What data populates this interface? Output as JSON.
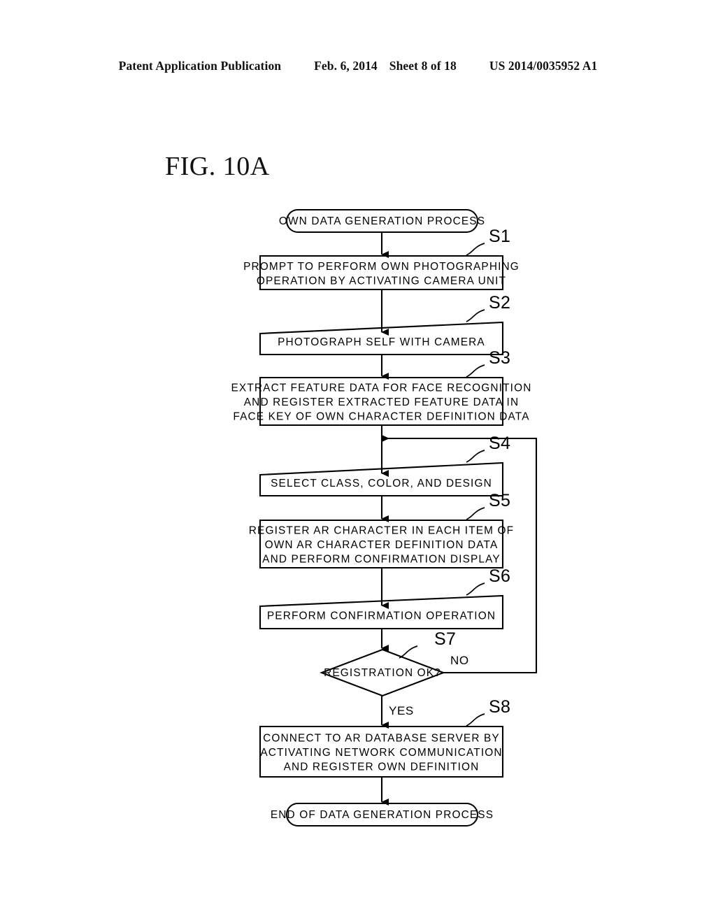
{
  "header": {
    "publication": "Patent Application Publication",
    "date": "Feb. 6, 2014",
    "sheet": "Sheet 8 of 18",
    "patent_number": "US 2014/0035952 A1"
  },
  "figure": {
    "label": "FIG. 10A"
  },
  "flowchart": {
    "start": {
      "id": "start",
      "type": "terminator",
      "text": "OWN DATA GENERATION PROCESS"
    },
    "end": {
      "id": "end",
      "type": "terminator",
      "text": "END OF DATA GENERATION PROCESS"
    },
    "steps": [
      {
        "id": "S1",
        "step_label": "S1",
        "type": "process",
        "lines": [
          "PROMPT TO PERFORM OWN PHOTOGRAPHING",
          "OPERATION BY ACTIVATING CAMERA UNIT"
        ]
      },
      {
        "id": "S2",
        "step_label": "S2",
        "type": "process",
        "lines": [
          "PHOTOGRAPH SELF WITH CAMERA"
        ]
      },
      {
        "id": "S3",
        "step_label": "S3",
        "type": "process",
        "lines": [
          "EXTRACT FEATURE DATA FOR FACE RECOGNITION",
          "AND REGISTER EXTRACTED FEATURE DATA IN",
          "FACE KEY OF OWN CHARACTER DEFINITION DATA"
        ]
      },
      {
        "id": "S4",
        "step_label": "S4",
        "type": "process",
        "lines": [
          "SELECT CLASS, COLOR, AND DESIGN"
        ]
      },
      {
        "id": "S5",
        "step_label": "S5",
        "type": "process",
        "lines": [
          "REGISTER AR CHARACTER IN EACH ITEM OF",
          "OWN AR CHARACTER DEFINITION DATA",
          "AND PERFORM CONFIRMATION DISPLAY"
        ]
      },
      {
        "id": "S6",
        "step_label": "S6",
        "type": "process",
        "lines": [
          "PERFORM CONFIRMATION OPERATION"
        ]
      },
      {
        "id": "S7",
        "step_label": "S7",
        "type": "decision",
        "lines": [
          "REGISTRATION OK?"
        ],
        "branch_yes": "YES",
        "branch_no": "NO"
      },
      {
        "id": "S8",
        "step_label": "S8",
        "type": "process",
        "lines": [
          "CONNECT TO AR DATABASE SERVER BY",
          "ACTIVATING NETWORK COMMUNICATION",
          "AND REGISTER OWN DEFINITION"
        ]
      }
    ],
    "connections": [
      {
        "from": "start",
        "to": "S1",
        "label": ""
      },
      {
        "from": "S1",
        "to": "S2",
        "label": ""
      },
      {
        "from": "S2",
        "to": "S3",
        "label": ""
      },
      {
        "from": "S3",
        "to": "S4",
        "label": ""
      },
      {
        "from": "S4",
        "to": "S5",
        "label": ""
      },
      {
        "from": "S5",
        "to": "S6",
        "label": ""
      },
      {
        "from": "S6",
        "to": "S7",
        "label": ""
      },
      {
        "from": "S7",
        "to": "S8",
        "label": "YES"
      },
      {
        "from": "S7",
        "to": "S4",
        "label": "NO"
      },
      {
        "from": "S8",
        "to": "end",
        "label": ""
      }
    ],
    "colors": {
      "ink": "#000000",
      "paper": "#ffffff"
    }
  }
}
